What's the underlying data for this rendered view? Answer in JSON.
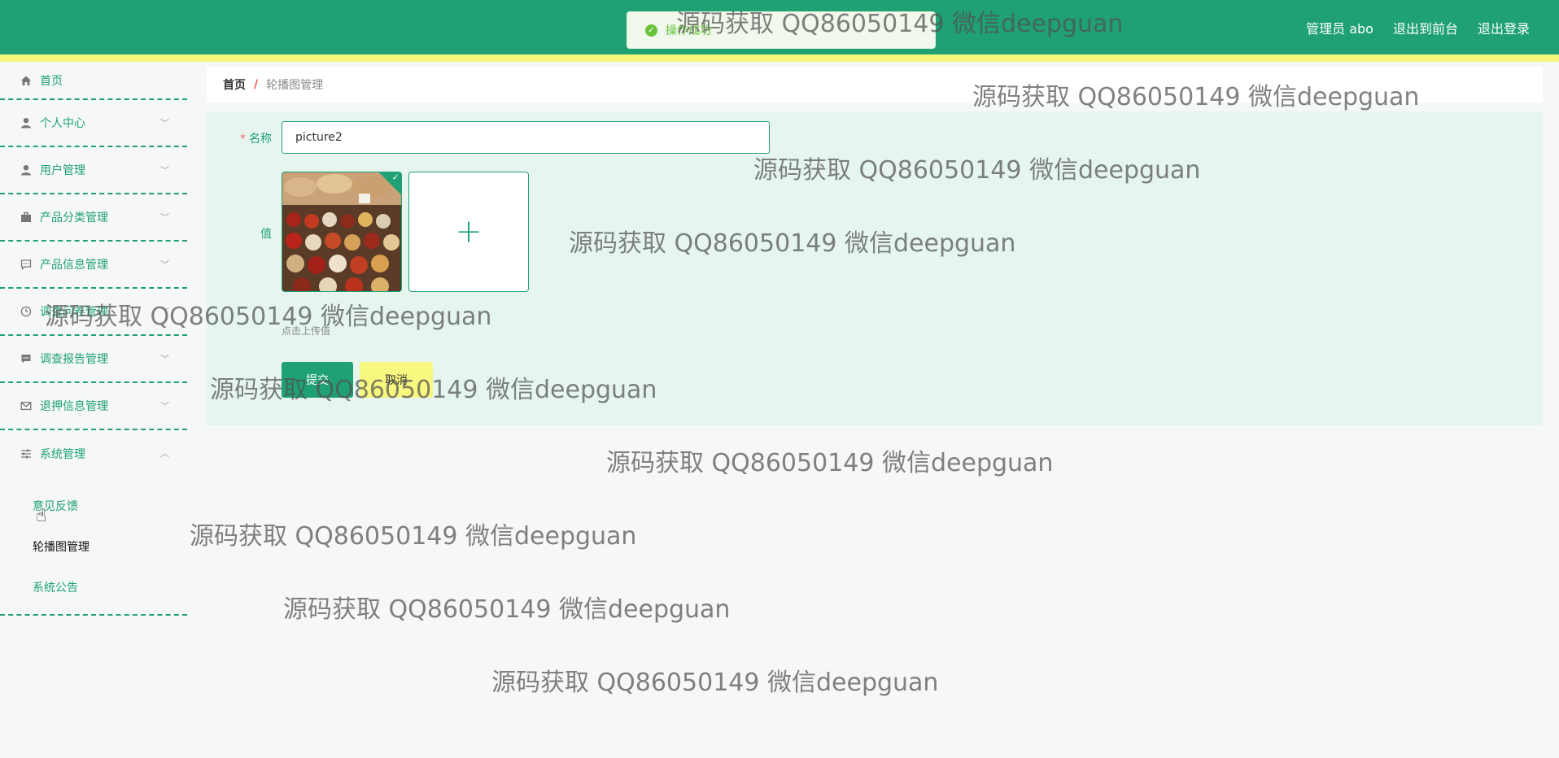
{
  "header": {
    "links": [
      "管理员 abo",
      "退出到前台",
      "退出登录"
    ],
    "toast": "操作成功"
  },
  "sidebar": {
    "items": [
      {
        "label": "首页",
        "icon": "home-icon"
      },
      {
        "label": "个人中心",
        "icon": "user-icon"
      },
      {
        "label": "用户管理",
        "icon": "user-icon"
      },
      {
        "label": "产品分类管理",
        "icon": "briefcase-icon"
      },
      {
        "label": "产品信息管理",
        "icon": "chat-icon"
      },
      {
        "label": "调查问卷管理",
        "icon": "clock-icon"
      },
      {
        "label": "调查报告管理",
        "icon": "message-icon"
      },
      {
        "label": "退押信息管理",
        "icon": "mail-icon"
      },
      {
        "label": "系统管理",
        "icon": "sliders-icon"
      }
    ],
    "sub_items": [
      "意见反馈",
      "轮播图管理",
      "系统公告"
    ]
  },
  "breadcrumb": {
    "home": "首页",
    "sep": "/",
    "current": "轮播图管理"
  },
  "form": {
    "name_label": "名称",
    "name_value": "picture2",
    "value_label": "值",
    "upload_plus": "+",
    "upload_hint": "点击上传值",
    "submit_label": "提交",
    "cancel_label": "取消"
  },
  "watermark": "源码获取 QQ86050149 微信deepguan",
  "colors": {
    "primary": "#1fa174",
    "accent": "#f8f77f",
    "danger": "#e0574b"
  }
}
